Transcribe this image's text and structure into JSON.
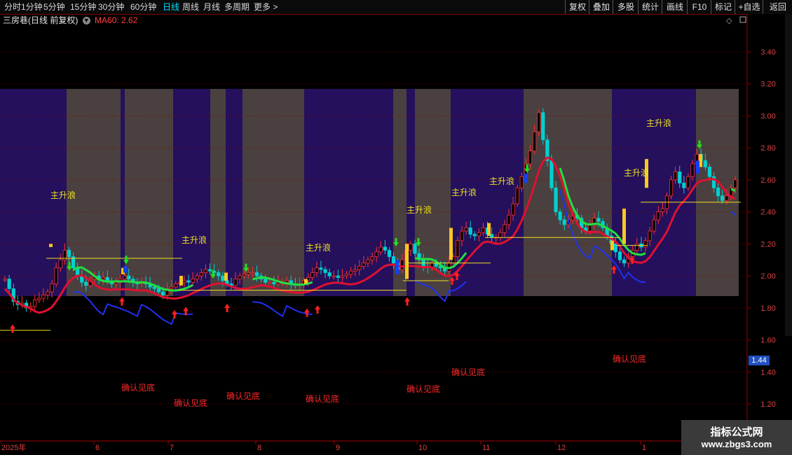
{
  "toolbar": {
    "left_items": [
      "分时",
      "1分钟",
      "5分钟",
      "15分钟",
      "30分钟",
      "60分钟",
      "日线",
      "周线",
      "月线",
      "多周期",
      "更多 >"
    ],
    "active": "日线",
    "right_items": [
      "复权",
      "叠加",
      "多股",
      "统计",
      "画线",
      "F10",
      "标记",
      "+自选",
      "返回"
    ]
  },
  "title": {
    "stock": "三房巷(日线 前复权)",
    "ma_label": "MA60: 2.62"
  },
  "yaxis": {
    "ticks": [
      "3.40",
      "3.20",
      "3.00",
      "2.80",
      "2.60",
      "2.40",
      "2.20",
      "2.00",
      "1.80",
      "1.60",
      "1.40",
      "1.20"
    ]
  },
  "xaxis": {
    "labels": [
      "2025年",
      "6",
      "7",
      "8",
      "9",
      "10",
      "11",
      "12",
      "1"
    ]
  },
  "annotations": {
    "up_wave": "主升浪",
    "confirm_bottom": "确认见底"
  },
  "price_tag": "1.44",
  "watermark": {
    "line1": "指标公式网",
    "line2": "www.zbgs3.com"
  },
  "chart_data": {
    "type": "candlestick",
    "y_range": [
      1.12,
      3.52
    ],
    "ma60_last": 2.62,
    "closes": [
      1.98,
      1.92,
      1.84,
      1.82,
      1.83,
      1.8,
      1.81,
      1.85,
      1.86,
      1.88,
      1.9,
      1.95,
      2.05,
      2.1,
      2.16,
      2.12,
      2.05,
      2.0,
      1.96,
      1.94,
      1.98,
      2.0,
      1.98,
      1.99,
      1.97,
      1.95,
      1.96,
      1.98,
      2.0,
      1.98,
      1.96,
      1.95,
      1.96,
      1.95,
      1.93,
      1.92,
      1.9,
      1.88,
      1.92,
      1.93,
      1.95,
      1.96,
      1.97,
      1.96,
      1.98,
      2.0,
      2.02,
      2.04,
      2.03,
      2.02,
      2.0,
      1.97,
      1.95,
      1.94,
      1.98,
      2.0,
      2.01,
      2.02,
      2.02,
      2.0,
      1.98,
      1.96,
      1.96,
      1.95,
      1.96,
      1.96,
      1.97,
      1.95,
      1.94,
      1.95,
      1.97,
      1.99,
      2.02,
      2.05,
      2.04,
      2.02,
      2.0,
      2.0,
      1.99,
      2.0,
      2.01,
      2.03,
      2.04,
      2.06,
      2.08,
      2.1,
      2.12,
      2.15,
      2.18,
      2.16,
      2.12,
      2.08,
      2.04,
      2.1,
      2.16,
      2.2,
      2.14,
      2.1,
      2.06,
      2.05,
      2.08,
      2.06,
      2.05,
      2.03,
      2.08,
      2.12,
      2.22,
      2.28,
      2.3,
      2.26,
      2.25,
      2.27,
      2.3,
      2.26,
      2.24,
      2.24,
      2.27,
      2.32,
      2.38,
      2.45,
      2.55,
      2.62,
      2.7,
      2.78,
      2.9,
      3.02,
      2.85,
      2.72,
      2.55,
      2.4,
      2.35,
      2.32,
      2.35,
      2.38,
      2.36,
      2.3,
      2.28,
      2.32,
      2.36,
      2.34,
      2.3,
      2.25,
      2.2,
      2.15,
      2.1,
      2.08,
      2.12,
      2.16,
      2.2,
      2.18,
      2.22,
      2.28,
      2.35,
      2.4,
      2.42,
      2.5,
      2.6,
      2.65,
      2.58,
      2.55,
      2.62,
      2.7,
      2.76,
      2.72,
      2.68,
      2.62,
      2.55,
      2.5,
      2.47,
      2.5,
      2.55,
      2.6
    ],
    "buy_arrow_count": 14,
    "sell_arrow_count": 9
  }
}
